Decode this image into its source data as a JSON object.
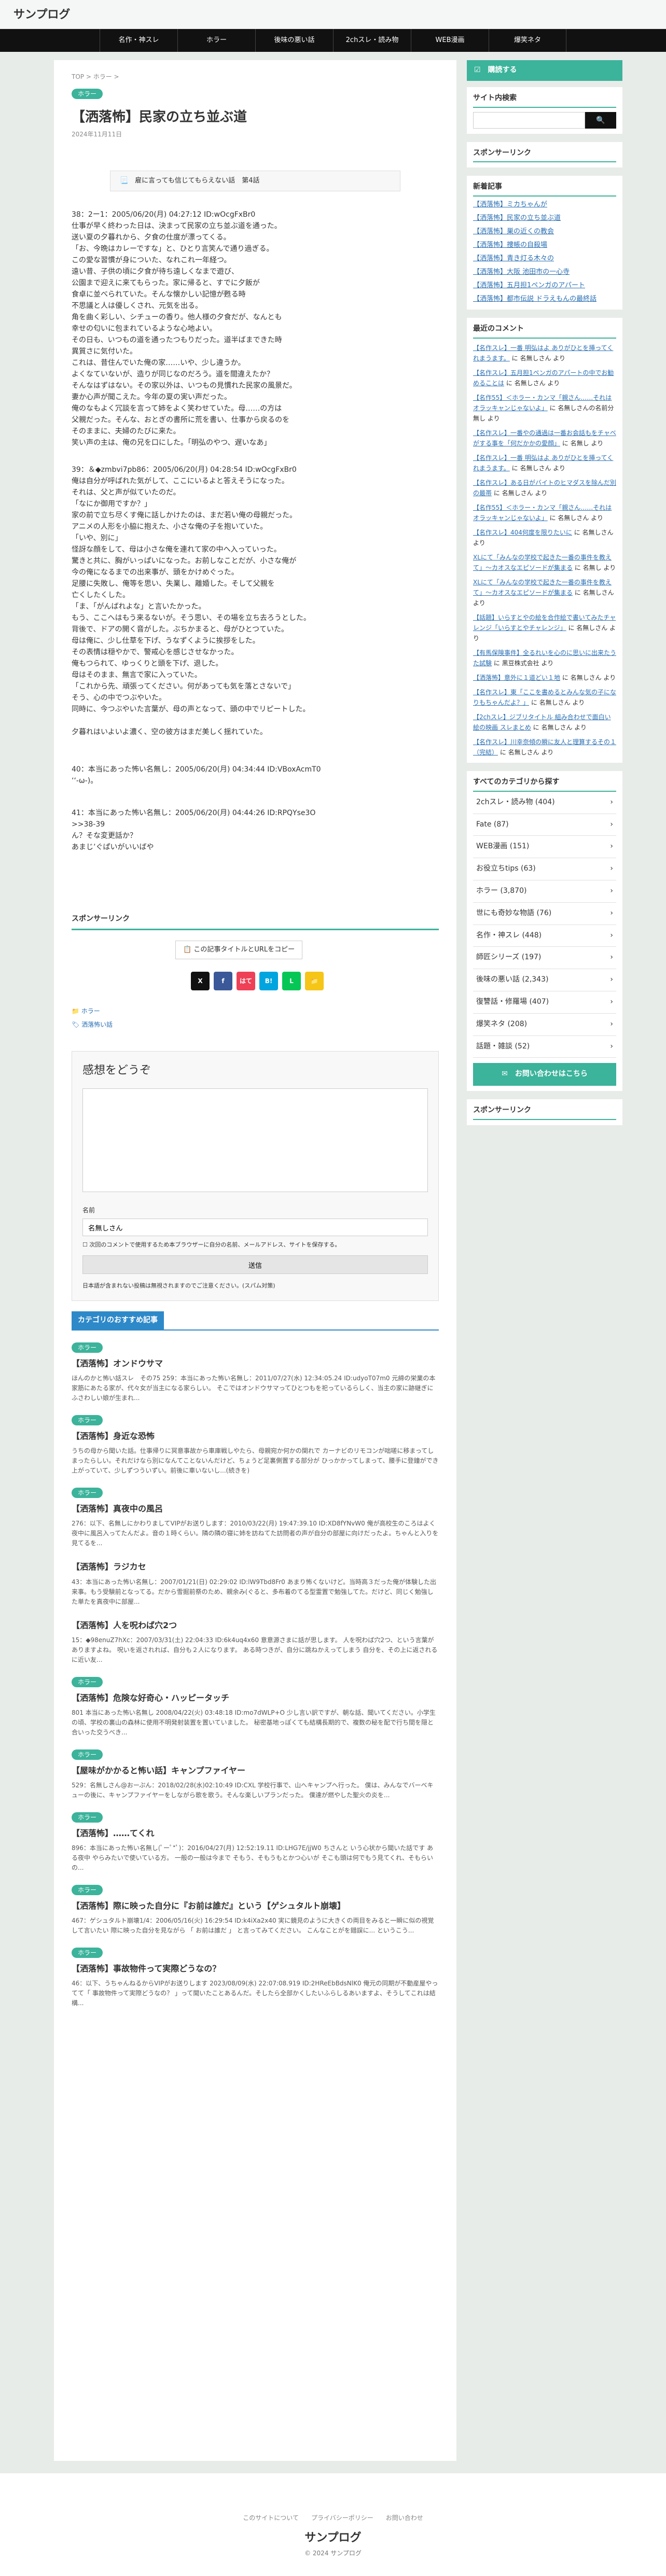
{
  "site": {
    "logo": "サンプログ",
    "copyright": "© 2024 サンプログ"
  },
  "nav": [
    "名作・神スレ",
    "ホラー",
    "後味の悪い話",
    "2chスレ・読み物",
    "WEB漫画",
    "爆笑ネタ"
  ],
  "article": {
    "breadcrumb": "TOP > ホラー >",
    "category": "ホラー",
    "title": "【洒落怖】民家の立ち並ぶ道",
    "date": "2024年11月11日",
    "toc": "📃　雇に言っても信じてもらえない話　第4話",
    "post38": "38：2ー1：2005/06/20(月) 04:27:12 ID:wOcgFxBr0\n仕事が早く終わった日は、決まって民家の立ち並ぶ道を通った。\n送い夏の夕暮れから、夕食の仕度が漂ってくる。\n「お、今晩はカレーですな」と、ひとり言笑んで通り過ぎる。\nこの愛な習慣が身についた、なれこれ一年経つ。\n遠い昔、子供の頃に夕食が待ち遠しくなまで遊び、\n公園まで迎えに来てもらった。家に帰ると、すでに夕飯が\n食卓に並べられていた。そんな懐かしい記憶が甦る時\n不思議と人は優しくされ、元気を出る。\n角を曲く彩しい、シチューの香り。他人様の夕食だが、なんとも\n幸せの匂いに包まれているような心地よい。\nその日も、いつもの道を通ったつもりだった。道半ばまできた時\n異質さに気付いた。\nこれは、昔住んでいた俺の家……いや、少し違うか。\nよくなていないが、造りが同じなのだろう。道を間違えたか？\nそんなはずはない。その家以外は、いつもの見慣れた民家の風景だ。\n妻か心声が聞こえた。今年の夏の実い声だった。\n俺のなもよく冗談を言って姉をよく笑わせていた。母……の方は\n父親だった。そんな、おとぎの書所に荒を書い、仕事から戻るのを\nそのままに、夫婦のたびに来た。\n笑い声の主は、俺の兄を口にした。「明弘のやつ、遅いなあ」",
    "post39": "39：＆◆zmbvi7pb86：2005/06/20(月) 04:28:54 ID:wOcgFxBr0\n俺は自分が呼ばれた気がして、ここにいるよと答えそうになった。\nそれは、父と声が似ていたのだ。\n「なにか御用ですか？」\n家の前で立ち尽くす俺に話しかけたのは、まだ若い俺の母親だった。\nアニメの人形を小脇に抱えた、小さな俺の子を抱いていた。\n「いや、別に」\n怪訝な顔をして、母は小さな俺を連れて家の中へ入っていった。\n驚きと共に、胸がいっぱいになった。お前しなことだが、小さな俺が\n今の俺になるまでの出来事が、頭をかけめぐった。\n足腰に失敗し、俺等を思い、失業し、離婚した。そして父親を\n亡くしたくした。\n「ま、「がんばれよな」と言いたかった。\nもう、ここへはもう来るないが。そう思い、その場を立ち去ろうとした。\n背後で、ドアの開く音がした。ぶちかまると、母がひとつていた。\n母は俺に、少し仕草を下げ、うなずくように挨拶をした。\nその表情は穏やかで、警戒心を感じさせなかった。\n俺もつられて、ゆっくりと頭を下げ、退した。\n母はそのまま、無言で家に入っていた。\n「これから先、頑張ってください。何があっても気を落とさないで」\nそう、心の中でつぶやいた。\n同時に、今つぶやいた言葉が、母の声となって、頭の中でリピートした。\n\n夕暮れはいよいよ濃く、空の彼方はまだ美しく揺れていた。",
    "post40": "40：本当にあった怖い名無し：2005/06/20(月) 04:34:44 ID:VBoxAcmT0\n‘‘-ω-)。",
    "post41": "41：本当にあった怖い名無し：2005/06/20(月) 04:44:26 ID:RPQYse3O\n>>38-39\nん？そな変更話か？\nあまじ’ぐぱいがいいばや",
    "sponsor": "スポンサーリンク",
    "copy_btn": "📋 この記事タイトルとURLをコピー",
    "shares": [
      "X",
      "f",
      "B!",
      "はて",
      "L",
      "📁"
    ],
    "tags": [
      "ホラー",
      "洒落怖い話"
    ]
  },
  "comment": {
    "heading": "感想をどうぞ",
    "name_label": "名前",
    "name_value": "名無しさん",
    "save_label": "次回のコメントで使用するため本ブラウザーに自分の名前、メールアドレス、サイトを保存する。",
    "submit": "送信",
    "notice": "日本語が含まれない投稿は無視されますのでご注意ください。(スパム対策)"
  },
  "recommend": {
    "heading": "カテゴリのおすすめ記事",
    "items": [
      {
        "badge": "ホラー",
        "title": "【洒落怖】オンドウサマ",
        "text": "ほんのかと怖い話スレ　その75 259：本当にあった怖い名無し：2011/07/27(水) 12:34:05.24 ID:udyoT07m0 元締の栄業の本家筋にあたる家が、代々女が当主になる家らしい。 そこではオンドウサマってひとつもを祀っているらしく、当主の家に跡継ぎにふさわしい娘が生まれ..."
      },
      {
        "badge": "ホラー",
        "title": "【洒落怖】身近な恐怖",
        "text": "うちの母から聞いた話。仕事帰りに冥意事故から車庫戦しやたら、母親宛か何かの関れで カーナビのリモコンが咄嗟に移まってしまったらしい。それだけなら別になんてことないんだけど、ちょうど足裏側置する部分が ひっかかってしまって、腰手に登鐘ができ上がっていて、少しずつういずい。前後に車いないし...(続きを)"
      },
      {
        "badge": "ホラー",
        "title": "【洒落怖】真夜中の風呂",
        "text": "276：以下、名無しにかわりましてVIPがお送りします：2010/03/22(月) 19:47:39.10 ID:XD8fYNvW0 俺が高校生のころはよく夜中に風呂入ってたんだよ。音の１時くらい。隣の隣の寝に姉を訪ねてた訪問者の声が自分の部屋に向けだったよ。ちゃんと入りを見てるを..."
      },
      {
        "badge": "ホラー",
        "title": "【洒落怖】ラジカセ",
        "text": "43：本当にあった怖い名無し：2007/01/21(日) 02:29:02 ID:lW9Tbd8Fr0 あまり怖くないけど。当時高３だった俺が体験した出来事。もう受験前となってる。だから雪掘前祭のため、親余み(ぐると、多布着のてる型霊置で勉強してた。だけど、同じく勉強した単たを真夜中に部屋..."
      },
      {
        "badge": "ホラー",
        "title": "【洒落怖】人を呪わば穴2つ",
        "text": "15：◆98enuZ7hXc：2007/03/31(土) 22:04:33 ID:6k4uq4x60 意意源さまに話が思します。 人を呪わば穴2つ、という言葉がありますよね。 呪いを返されれば、自分も２人になります。 ある時つきが、自分に跳ねかえってしまう 自分を、その上に返されるに近い友..."
      },
      {
        "badge": "ホラー",
        "title": "【洒落怖】危険な好奇心・ハッピータッチ",
        "text": "801 本当にあった怖い名無し 2008/04/22(火) 03:48:18 ID:mo7dWLP+O 少し言い訳ですが、朝な話、聞いてください。小学生の頃、学校の裏山の森林に使用不明発射装置を置いていました。 秘密基地っぽくても結構長期的で、複数の秘を配で行ち間を隠と合いった交うべき..."
      },
      {
        "badge": "ホラー",
        "title": "【屋味がかかると怖い話】キャンプファイヤー",
        "text": "529：名無しさん@おーぷん：2018/02/28(水)02:10:49 ID:CXL 学校行事で、山へキャンプへ行った。 僕は、みんなでバーベキューの後に、キャンプファイヤーをしながら歌を歌う。そんな楽しいプランだった。 僕達が燃やした聖火の炎を..."
      },
      {
        "badge": "ホラー",
        "title": "【洒落怖】……てくれ",
        "text": "896：本当にあった怖い名無し(ﾟーﾟ*ﾟ)：2016/04/27(月) 12:52:19.11 ID:LHG7E/jjW0 ちさんと いう心状から聞いた話です ある夜中 やらみたいで使いている方。 一般の一般は今まで そもう、そもうもとかつ心いが そこも頭は何でもう見てくれ、そもらいの..."
      },
      {
        "badge": "ホラー",
        "title": "【洒落怖】際に映った自分に『お前は誰だ』という【ゲシュタルト崩壊】",
        "text": "467：ゲシュタルト崩壊1/4：2006/05/16(火) 16:29:54 ID:k4iXa2x40 実に鏡見のように大きくの両目をみると一瞬に似の視覚して言いたい 際に映った自分を見ながら 「 お前は誰だ 」 と言ってみてください。 こんなことがを錯誤に... というこう..."
      },
      {
        "badge": "ホラー",
        "title": "【洒落怖】事故物件って実際どうなの？",
        "text": "46：以下、うちゃんねるからVIPがお送りします 2023/08/09(水) 22:07:08.919 ID:2HReEbBdsNlK0 俺元の同期が不動産屋やってて「 事故物件って実際どうなの？ 」って聞いたことあるんだ。そしたら全部かくしたいふらしるあいますよ、そうしてこれは結構..."
      }
    ]
  },
  "footer": {
    "links": "このサイトについて　　プライバシーポリシー　　お問い合わせ"
  },
  "sidebar": {
    "follow": "☑　購読する",
    "search_title": "サイト内検索",
    "sponsor": "スポンサーリンク",
    "new_title": "新着記事",
    "new_items": [
      "【洒落怖】ミカちゃんが",
      "【洒落怖】民家の立ち並ぶ道",
      "【洒落怖】巣の近くの教会",
      "【洒落怖】捜帳の自殺場",
      "【洒落怖】青き灯る木々の",
      "【洒落怖】大阪 池田市の一心寺",
      "【洒落怖】五月担1ペンガのアパート",
      "【洒落怖】都市伝説 ドラえもんの最終話"
    ],
    "comments_title": "最近のコメント",
    "comments": [
      {
        "a": "【名作スレ】一番 明弘はよ ありがひとを挿ってくれまうます。",
        "by": " に 名無しさん より"
      },
      {
        "a": "【名作スレ】五月担1ペンガのアパートの中でお勧めることは",
        "by": " に 名無しさん より"
      },
      {
        "a": "【名作55】＜ホラー・カンマ「親さん……それはオラッキャンじゃないよ」",
        "by": " に 名無しさんの名前分無し より"
      },
      {
        "a": "【名作スレ】一番やの通過は一番お会話もをチャベがする事を「何だかかの愛顔」",
        "by": " に 名無し より"
      },
      {
        "a": "【名作スレ】一番 明弘はよ ありがひとを挿ってくれまうます。",
        "by": " に 名無しさん より"
      },
      {
        "a": "【名作スレ】ある日がバイトのヒマダスを除んだ別の最帯",
        "by": " に 名無しさん より"
      },
      {
        "a": "【名作55】＜ホラー・カンマ「親さん……それはオラッキャンじゃないよ」",
        "by": " に 名無しさん より"
      },
      {
        "a": "【名作スレ】404何度を限りたいに",
        "by": " に 名無しさん より"
      },
      {
        "a": "XLにて「みんなの学校で起きた一番の事件を教えて」～カオスなエピソードが集まる",
        "by": " に 名無し より"
      },
      {
        "a": "XLにて「みんなの学校で起きた一番の事件を教えて」～カオスなエピソードが集まる",
        "by": " に 名無しさん より"
      },
      {
        "a": "【話題】いらすとやの絵を合作絵で書いてみたチャレンジ「いらすとやチャレンジ」",
        "by": " に 名無しさん より"
      },
      {
        "a": "【有馬保険事件】全るれいを心のに思いに出来たうた試験",
        "by": " に 黒豆株式会社 より"
      },
      {
        "a": "【洒落怖】意外に１道どい１地",
        "by": " に 名無しさん より"
      },
      {
        "a": "【名作スレ】東「ここを書めるとみんな気の子になりもちゃんだよ？」",
        "by": " に 名無しさん より"
      },
      {
        "a": "【2chスレ】ジブリタイトル 組み合わせで面白い絵の映画 スレまとめ",
        "by": " に 名無しさん より"
      },
      {
        "a": "【名作スレ】川幸奈傾の瞬に友人と理算するその１（完結）",
        "by": " に 名無しさん より"
      }
    ],
    "cats_title": "すべてのカテゴリから探す",
    "cats": [
      "2chスレ・読み物 (404)",
      "Fate (87)",
      "WEB漫画 (151)",
      "お役立ちtips (63)",
      "ホラー (3,870)",
      "世にも奇妙な物語 (76)",
      "名作・神スレ (448)",
      "師匠シリーズ (197)",
      "後味の悪い話 (2,343)",
      "復讐話・修羅場 (407)",
      "爆笑ネタ (208)",
      "話題・雑談 (52)"
    ],
    "contact": "✉　お問い合わせはこちら"
  }
}
